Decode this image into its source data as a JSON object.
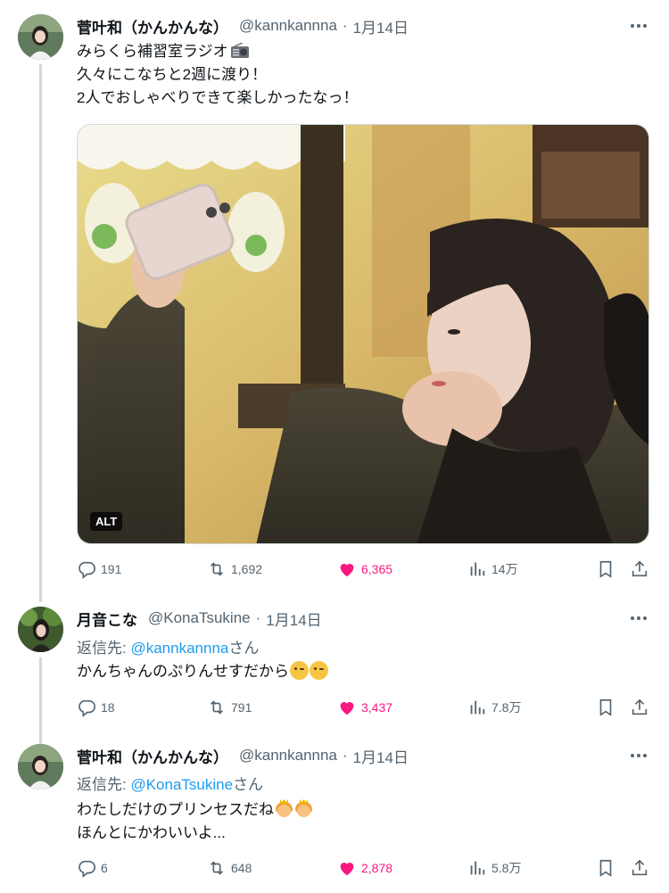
{
  "tweets": [
    {
      "name": "菅叶和（かんかんな）",
      "handle": "@kannkannna",
      "dot": "·",
      "date": "1月14日",
      "lines": [
        "みらくら補習室ラジオ",
        "久々にこなちと2週に渡り！",
        "2人でおしゃべりできて楽しかったなっ！"
      ],
      "media_alt_badge": "ALT",
      "stats": {
        "replies": "191",
        "retweets": "1,692",
        "likes": "6,365",
        "views": "14万"
      }
    },
    {
      "name": "月音こな",
      "handle": "@KonaTsukine",
      "dot": "·",
      "date": "1月14日",
      "reply_prefix": "返信先: ",
      "reply_mention": "@kannkannna",
      "reply_suffix": "さん",
      "lines": [
        "かんちゃんのぷりんせすだから"
      ],
      "stats": {
        "replies": "18",
        "retweets": "791",
        "likes": "3,437",
        "views": "7.8万"
      }
    },
    {
      "name": "菅叶和（かんかんな）",
      "handle": "@kannkannna",
      "dot": "·",
      "date": "1月14日",
      "reply_prefix": "返信先: ",
      "reply_mention": "@KonaTsukine",
      "reply_suffix": "さん",
      "lines": [
        "わたしだけのプリンセスだね",
        "ほんとにかわいいよ..."
      ],
      "stats": {
        "replies": "6",
        "retweets": "648",
        "likes": "2,878",
        "views": "5.8万"
      }
    }
  ],
  "icons": [
    "reply-icon",
    "retweet-icon",
    "like-icon",
    "views-icon",
    "bookmark-icon",
    "share-icon",
    "more-icon",
    "radio-icon",
    "wink-emoji",
    "princess-emoji"
  ],
  "colors": {
    "like": "#f91880",
    "link": "#1d9bf0",
    "muted": "#536471",
    "thread": "#cfd9de"
  }
}
